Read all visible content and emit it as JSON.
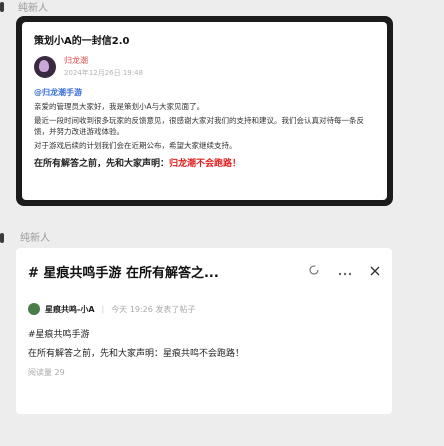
{
  "messages": [
    {
      "sender": "纯新人",
      "card": {
        "title": "策划小A的一封信2.0",
        "author_name": "归龙潮",
        "date": "2024年12月26日 19:48",
        "tag": "@归龙潮手游",
        "paragraph1": "亲爱的管理员大家好，我是策划小A与大家见面了。",
        "paragraph2": "最近一段时间收到很多玩家的反馈意见，很感谢大家对我们的支持和建议。我们会认真对待每一条反馈，并努力改进游戏体验。",
        "paragraph3": "对于游戏后续的计划我们会在近期公布，希望大家继续支持。",
        "ending_prefix": "在所有解答之前，先和大家声明：",
        "ending_highlight": "归龙潮不会跑路！"
      }
    },
    {
      "sender": "纯新人",
      "card": {
        "title": "# 星痕共鸣手游 在所有解答之...",
        "author_name": "星痕共鸣-小A",
        "time": "今天 19:26 发表了帖子",
        "line1": "#星痕共鸣手游",
        "line2": "在所有解答之前，先和大家声明：星痕共鸣不会跑路！",
        "read_count": "阅读量 29"
      }
    }
  ],
  "icons": {
    "refresh": "refresh-icon",
    "more": "more-icon",
    "close": "close-icon"
  }
}
